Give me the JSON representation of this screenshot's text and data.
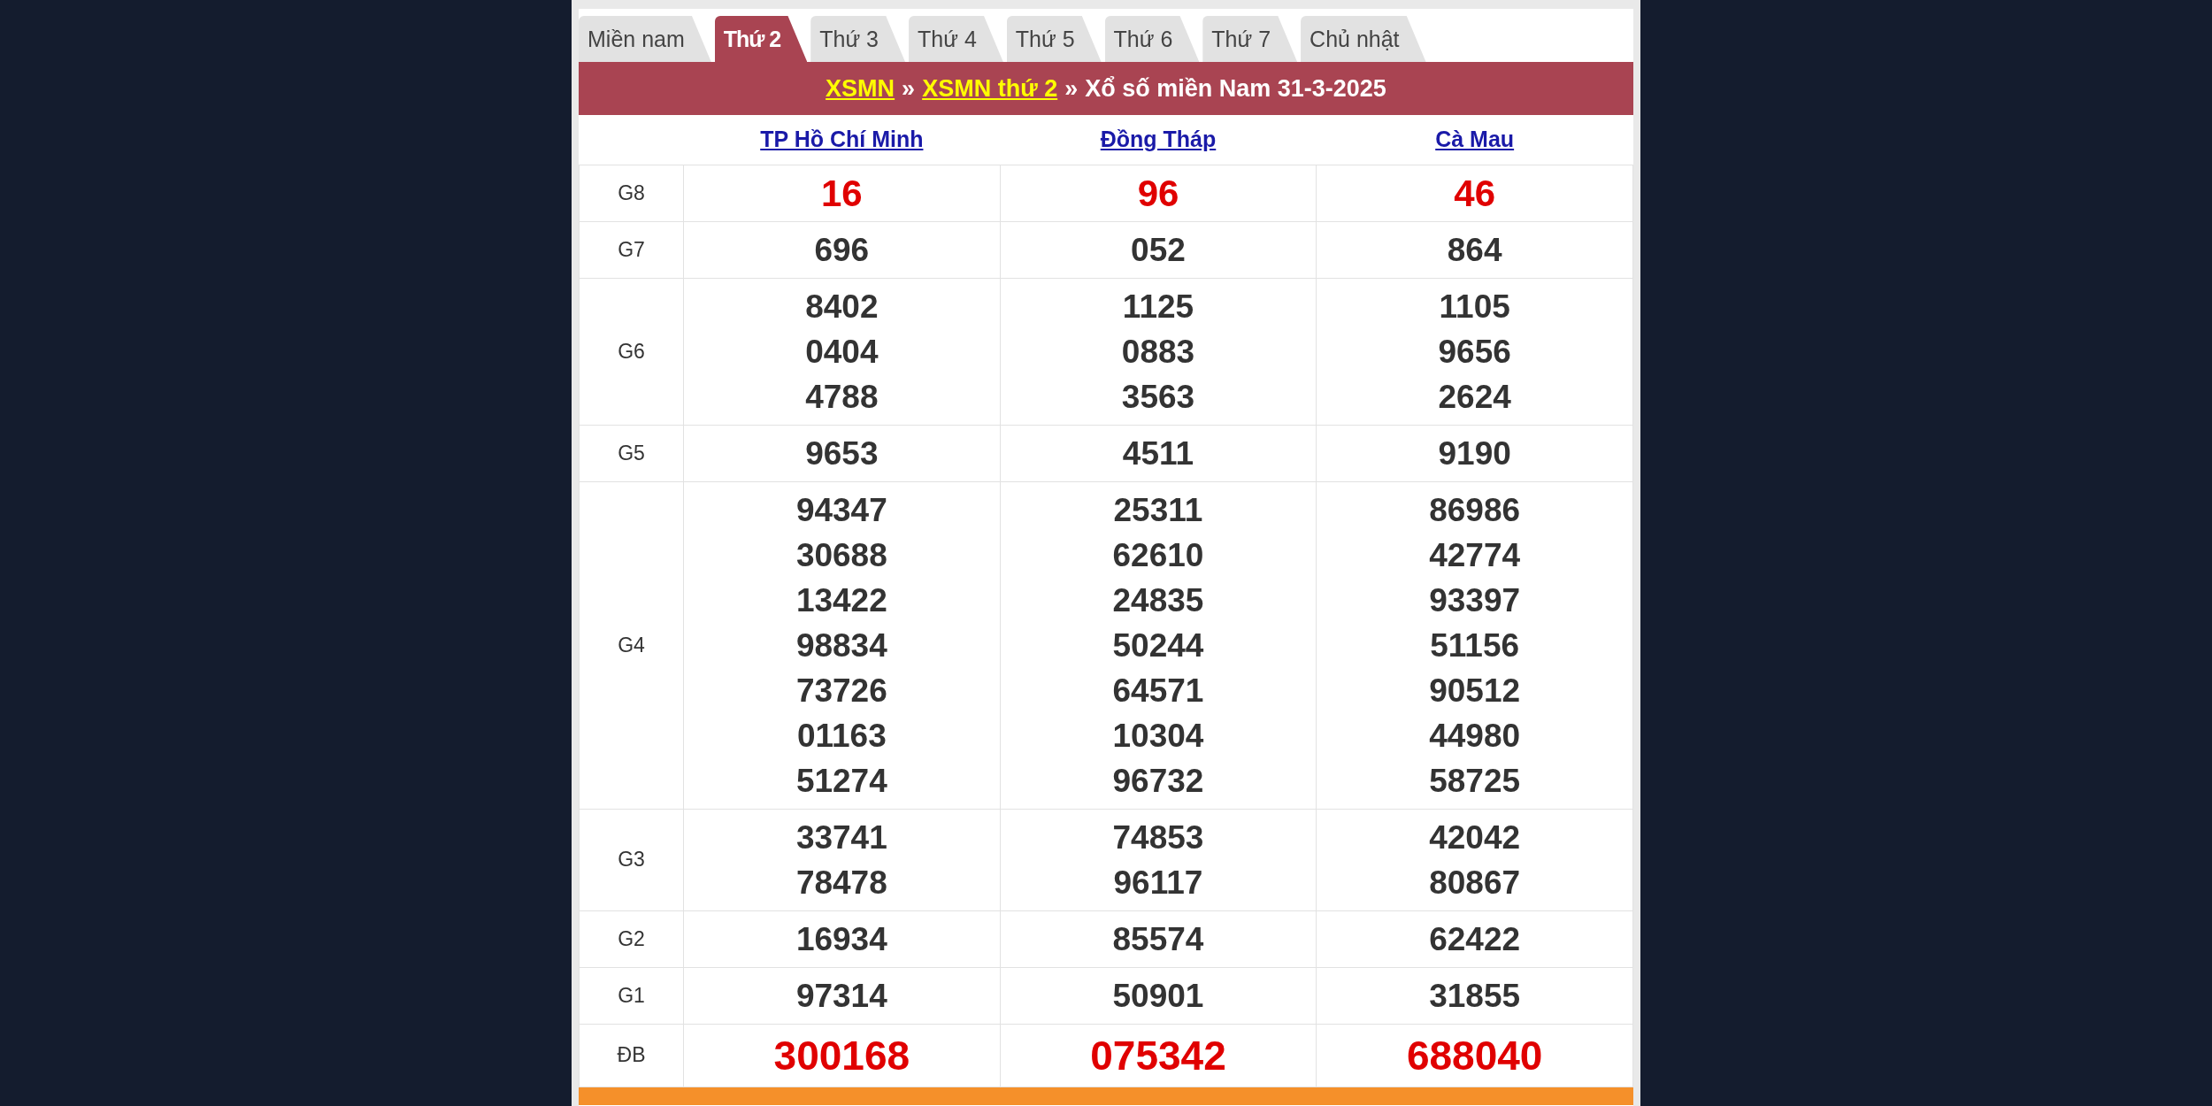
{
  "tabs": [
    {
      "label": "Miền nam",
      "selected": false
    },
    {
      "label": "Thứ 2",
      "selected": true
    },
    {
      "label": "Thứ 3",
      "selected": false
    },
    {
      "label": "Thứ 4",
      "selected": false
    },
    {
      "label": "Thứ 5",
      "selected": false
    },
    {
      "label": "Thứ 6",
      "selected": false
    },
    {
      "label": "Thứ 7",
      "selected": false
    },
    {
      "label": "Chủ nhật",
      "selected": false
    }
  ],
  "breadcrumb": [
    {
      "kind": "link",
      "text": "XSMN"
    },
    {
      "kind": "separator",
      "text": "»"
    },
    {
      "kind": "link",
      "text": "XSMN thứ 2"
    },
    {
      "kind": "separator",
      "text": "»"
    },
    {
      "kind": "text",
      "text": "Xổ số miền Nam 31-3-2025"
    }
  ],
  "provinces": [
    "TP Hồ Chí Minh",
    "Đồng Tháp",
    "Cà Mau"
  ],
  "prizes": [
    {
      "label": "G8",
      "kind": "highlight",
      "values": [
        [
          "16"
        ],
        [
          "96"
        ],
        [
          "46"
        ]
      ]
    },
    {
      "label": "G7",
      "kind": "normal",
      "values": [
        [
          "696"
        ],
        [
          "052"
        ],
        [
          "864"
        ]
      ]
    },
    {
      "label": "G6",
      "kind": "normal",
      "values": [
        [
          "8402",
          "0404",
          "4788"
        ],
        [
          "1125",
          "0883",
          "3563"
        ],
        [
          "1105",
          "9656",
          "2624"
        ]
      ]
    },
    {
      "label": "G5",
      "kind": "normal",
      "values": [
        [
          "9653"
        ],
        [
          "4511"
        ],
        [
          "9190"
        ]
      ]
    },
    {
      "label": "G4",
      "kind": "normal",
      "values": [
        [
          "94347",
          "30688",
          "13422",
          "98834",
          "73726",
          "01163",
          "51274"
        ],
        [
          "25311",
          "62610",
          "24835",
          "50244",
          "64571",
          "10304",
          "96732"
        ],
        [
          "86986",
          "42774",
          "93397",
          "51156",
          "90512",
          "44980",
          "58725"
        ]
      ]
    },
    {
      "label": "G3",
      "kind": "normal",
      "values": [
        [
          "33741",
          "78478"
        ],
        [
          "74853",
          "96117"
        ],
        [
          "42042",
          "80867"
        ]
      ]
    },
    {
      "label": "G2",
      "kind": "normal",
      "values": [
        [
          "16934"
        ],
        [
          "85574"
        ],
        [
          "62422"
        ]
      ]
    },
    {
      "label": "G1",
      "kind": "normal",
      "values": [
        [
          "97314"
        ],
        [
          "50901"
        ],
        [
          "31855"
        ]
      ]
    },
    {
      "label": "ĐB",
      "kind": "special",
      "values": [
        [
          "300168"
        ],
        [
          "075342"
        ],
        [
          "688040"
        ]
      ]
    }
  ]
}
